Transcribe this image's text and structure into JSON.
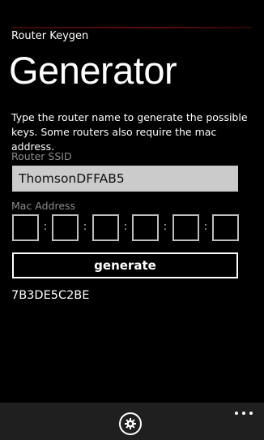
{
  "app": {
    "title": "Router Keygen"
  },
  "page": {
    "title": "Generator",
    "description": "Type the router name to generate the possible keys. Some routers also require the mac address."
  },
  "form": {
    "ssid_label": "Router SSID",
    "ssid_value": "ThomsonDFFAB5",
    "mac_label": "Mac Address",
    "mac_octets": [
      "",
      "",
      "",
      "",
      "",
      ""
    ],
    "mac_separator": ":",
    "generate_label": "generate"
  },
  "result": {
    "keys": [
      "7B3DE5C2BE"
    ]
  },
  "app_bar": {
    "settings_icon": "gear-icon",
    "more_icon": "ellipsis-icon",
    "background": "#1f1f1f"
  },
  "colors": {
    "background": "#000000",
    "foreground": "#ffffff",
    "label": "#8c8c8c",
    "input_background": "#cbcbcb"
  }
}
